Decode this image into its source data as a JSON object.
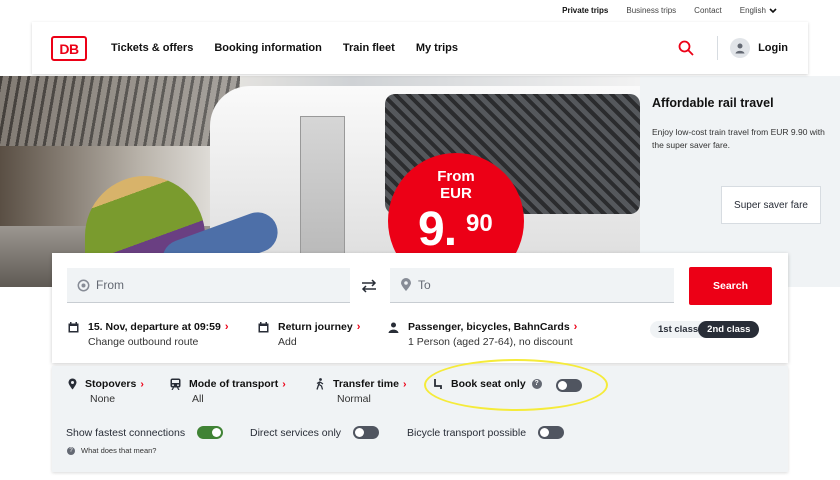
{
  "meta_nav": {
    "private_trips": "Private trips",
    "business_trips": "Business trips",
    "contact": "Contact",
    "language": "English"
  },
  "header": {
    "logo_text": "DB",
    "nav": [
      "Tickets & offers",
      "Booking information",
      "Train fleet",
      "My trips"
    ],
    "login": "Login"
  },
  "hero": {
    "badge_from": "From",
    "badge_currency": "EUR",
    "badge_price_main": "9.",
    "badge_price_cents": "90"
  },
  "promo": {
    "title": "Affordable rail travel",
    "text": "Enjoy low-cost train travel from EUR 9.90 with the super saver fare.",
    "button": "Super saver fare"
  },
  "search": {
    "from_placeholder": "From",
    "to_placeholder": "To",
    "search_button": "Search",
    "date_title": "15. Nov, departure at 09:59",
    "date_sub": "Change outbound route",
    "return_title": "Return journey",
    "return_sub": "Add",
    "passenger_title": "Passenger, bicycles, BahnCards",
    "passenger_sub": "1 Person (aged 27-64), no discount",
    "class_first": "1st class",
    "class_second": "2nd class",
    "selected_class": "2nd class"
  },
  "extended": {
    "stopovers_title": "Stopovers",
    "stopovers_value": "None",
    "mode_title": "Mode of transport",
    "mode_value": "All",
    "transfer_title": "Transfer time",
    "transfer_value": "Normal",
    "seat_title": "Book seat only",
    "seat_only_on": false,
    "fastest_label": "Show fastest connections",
    "fastest_on": true,
    "direct_label": "Direct services only",
    "direct_on": false,
    "bicycle_label": "Bicycle transport possible",
    "bicycle_on": false,
    "what_label": "What does that mean?"
  },
  "colors": {
    "brand_red": "#ec0016",
    "highlight_yellow": "#f5eb3a",
    "toggle_on": "#408335",
    "dark": "#282d37"
  }
}
